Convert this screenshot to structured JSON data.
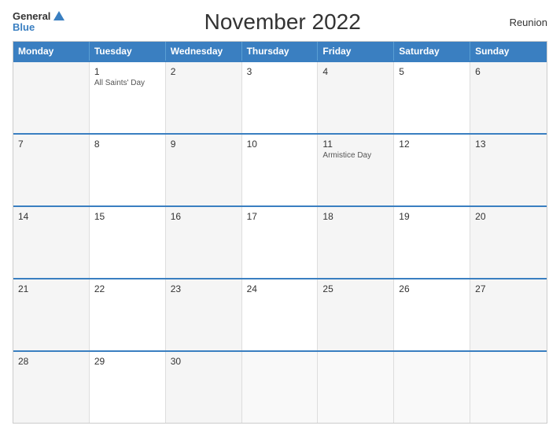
{
  "header": {
    "logo_general": "General",
    "logo_blue": "Blue",
    "title": "November 2022",
    "region": "Reunion"
  },
  "weekdays": [
    "Monday",
    "Tuesday",
    "Wednesday",
    "Thursday",
    "Friday",
    "Saturday",
    "Sunday"
  ],
  "weeks": [
    [
      {
        "num": "",
        "event": "",
        "bg": "alt"
      },
      {
        "num": "1",
        "event": "All Saints' Day",
        "bg": ""
      },
      {
        "num": "2",
        "event": "",
        "bg": "alt"
      },
      {
        "num": "3",
        "event": "",
        "bg": ""
      },
      {
        "num": "4",
        "event": "",
        "bg": "alt"
      },
      {
        "num": "5",
        "event": "",
        "bg": ""
      },
      {
        "num": "6",
        "event": "",
        "bg": "alt"
      }
    ],
    [
      {
        "num": "7",
        "event": "",
        "bg": "alt"
      },
      {
        "num": "8",
        "event": "",
        "bg": ""
      },
      {
        "num": "9",
        "event": "",
        "bg": "alt"
      },
      {
        "num": "10",
        "event": "",
        "bg": ""
      },
      {
        "num": "11",
        "event": "Armistice Day",
        "bg": "alt"
      },
      {
        "num": "12",
        "event": "",
        "bg": ""
      },
      {
        "num": "13",
        "event": "",
        "bg": "alt"
      }
    ],
    [
      {
        "num": "14",
        "event": "",
        "bg": "alt"
      },
      {
        "num": "15",
        "event": "",
        "bg": ""
      },
      {
        "num": "16",
        "event": "",
        "bg": "alt"
      },
      {
        "num": "17",
        "event": "",
        "bg": ""
      },
      {
        "num": "18",
        "event": "",
        "bg": "alt"
      },
      {
        "num": "19",
        "event": "",
        "bg": ""
      },
      {
        "num": "20",
        "event": "",
        "bg": "alt"
      }
    ],
    [
      {
        "num": "21",
        "event": "",
        "bg": "alt"
      },
      {
        "num": "22",
        "event": "",
        "bg": ""
      },
      {
        "num": "23",
        "event": "",
        "bg": "alt"
      },
      {
        "num": "24",
        "event": "",
        "bg": ""
      },
      {
        "num": "25",
        "event": "",
        "bg": "alt"
      },
      {
        "num": "26",
        "event": "",
        "bg": ""
      },
      {
        "num": "27",
        "event": "",
        "bg": "alt"
      }
    ],
    [
      {
        "num": "28",
        "event": "",
        "bg": "alt"
      },
      {
        "num": "29",
        "event": "",
        "bg": ""
      },
      {
        "num": "30",
        "event": "",
        "bg": "alt"
      },
      {
        "num": "",
        "event": "",
        "bg": "empty"
      },
      {
        "num": "",
        "event": "",
        "bg": "empty"
      },
      {
        "num": "",
        "event": "",
        "bg": "empty"
      },
      {
        "num": "",
        "event": "",
        "bg": "empty"
      }
    ]
  ]
}
